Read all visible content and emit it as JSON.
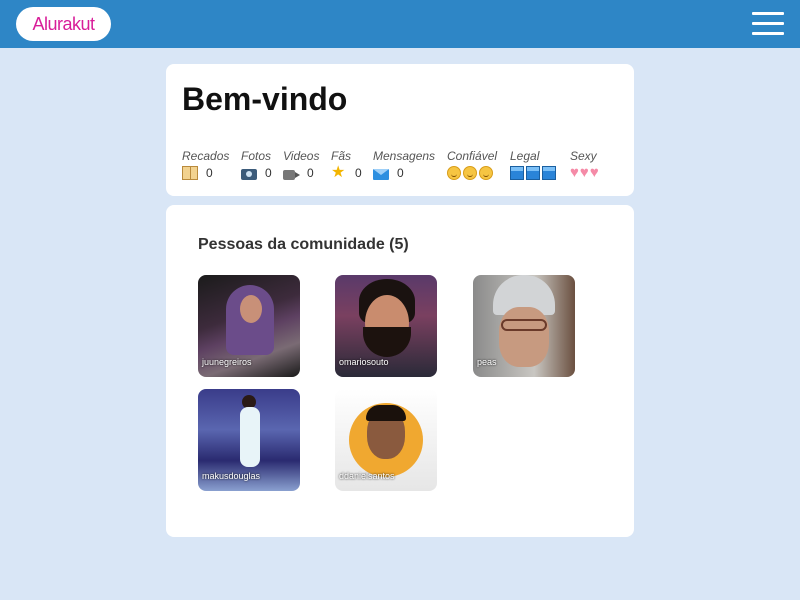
{
  "header": {
    "logo_text": "Alurakut",
    "menu_icon": "hamburger-menu-icon",
    "background_color": "#2e86c6"
  },
  "welcome": {
    "title": "Bem-vindo",
    "stats": [
      {
        "label": "Recados",
        "icon": "book-icon",
        "value": "0"
      },
      {
        "label": "Fotos",
        "icon": "camera-icon",
        "value": "0"
      },
      {
        "label": "Videos",
        "icon": "video-camera-icon",
        "value": "0"
      },
      {
        "label": "Fãs",
        "icon": "star-icon",
        "value": "0"
      },
      {
        "label": "Mensagens",
        "icon": "envelope-icon",
        "value": "0"
      }
    ],
    "ratings": [
      {
        "label": "Confiável",
        "icon": "smiley-icon",
        "count": 3
      },
      {
        "label": "Legal",
        "icon": "cube-icon",
        "count": 3
      },
      {
        "label": "Sexy",
        "icon": "heart-icon",
        "count": 3
      }
    ]
  },
  "community": {
    "title": "Pessoas da comunidade (5)",
    "people": [
      {
        "username": "juunegreiros"
      },
      {
        "username": "omariosouto"
      },
      {
        "username": "peas"
      },
      {
        "username": "makusdouglas"
      },
      {
        "username": "ddanielsantos"
      }
    ]
  }
}
